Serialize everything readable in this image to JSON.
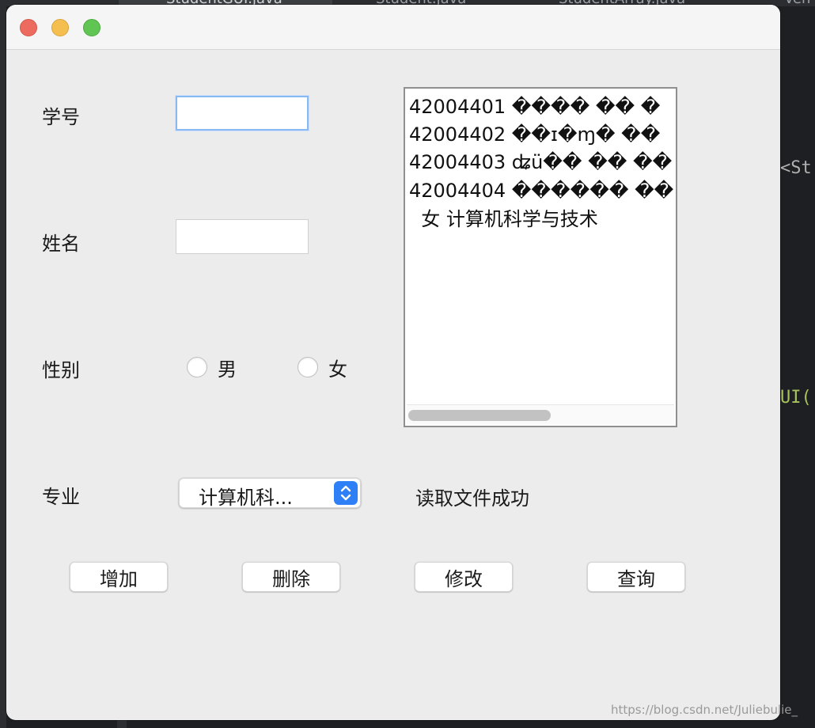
{
  "ide": {
    "tabs": [
      "StudentGUI.java",
      "Student.java",
      "StudentArray.java",
      "Ven"
    ],
    "code_fragments": [
      "<St",
      "UI("
    ]
  },
  "window": {
    "form": {
      "id_label": "学号",
      "id_value": "",
      "name_label": "姓名",
      "name_value": "",
      "gender_label": "性别",
      "gender_options": [
        "男",
        "女"
      ],
      "major_label": "专业",
      "major_selected": "计算机科..."
    },
    "output": {
      "lines": [
        "42004401 ���� �� �",
        "42004402 ��ɪ�ɱ� ��",
        "42004403 ʥü�� �� ��",
        "42004404 ������ ��",
        "  女 计算机科学与技术"
      ]
    },
    "status_text": "读取文件成功",
    "buttons": {
      "add": "增加",
      "delete": "删除",
      "modify": "修改",
      "query": "查询"
    }
  },
  "watermark": "https://blog.csdn.net/Juliebulie_",
  "colors": {
    "window_bg": "#ececec",
    "accent_blue": "#2f7ff6",
    "close_red": "#ed6a5e",
    "minimize_yellow": "#f5bf4f",
    "maximize_green": "#61c554"
  }
}
